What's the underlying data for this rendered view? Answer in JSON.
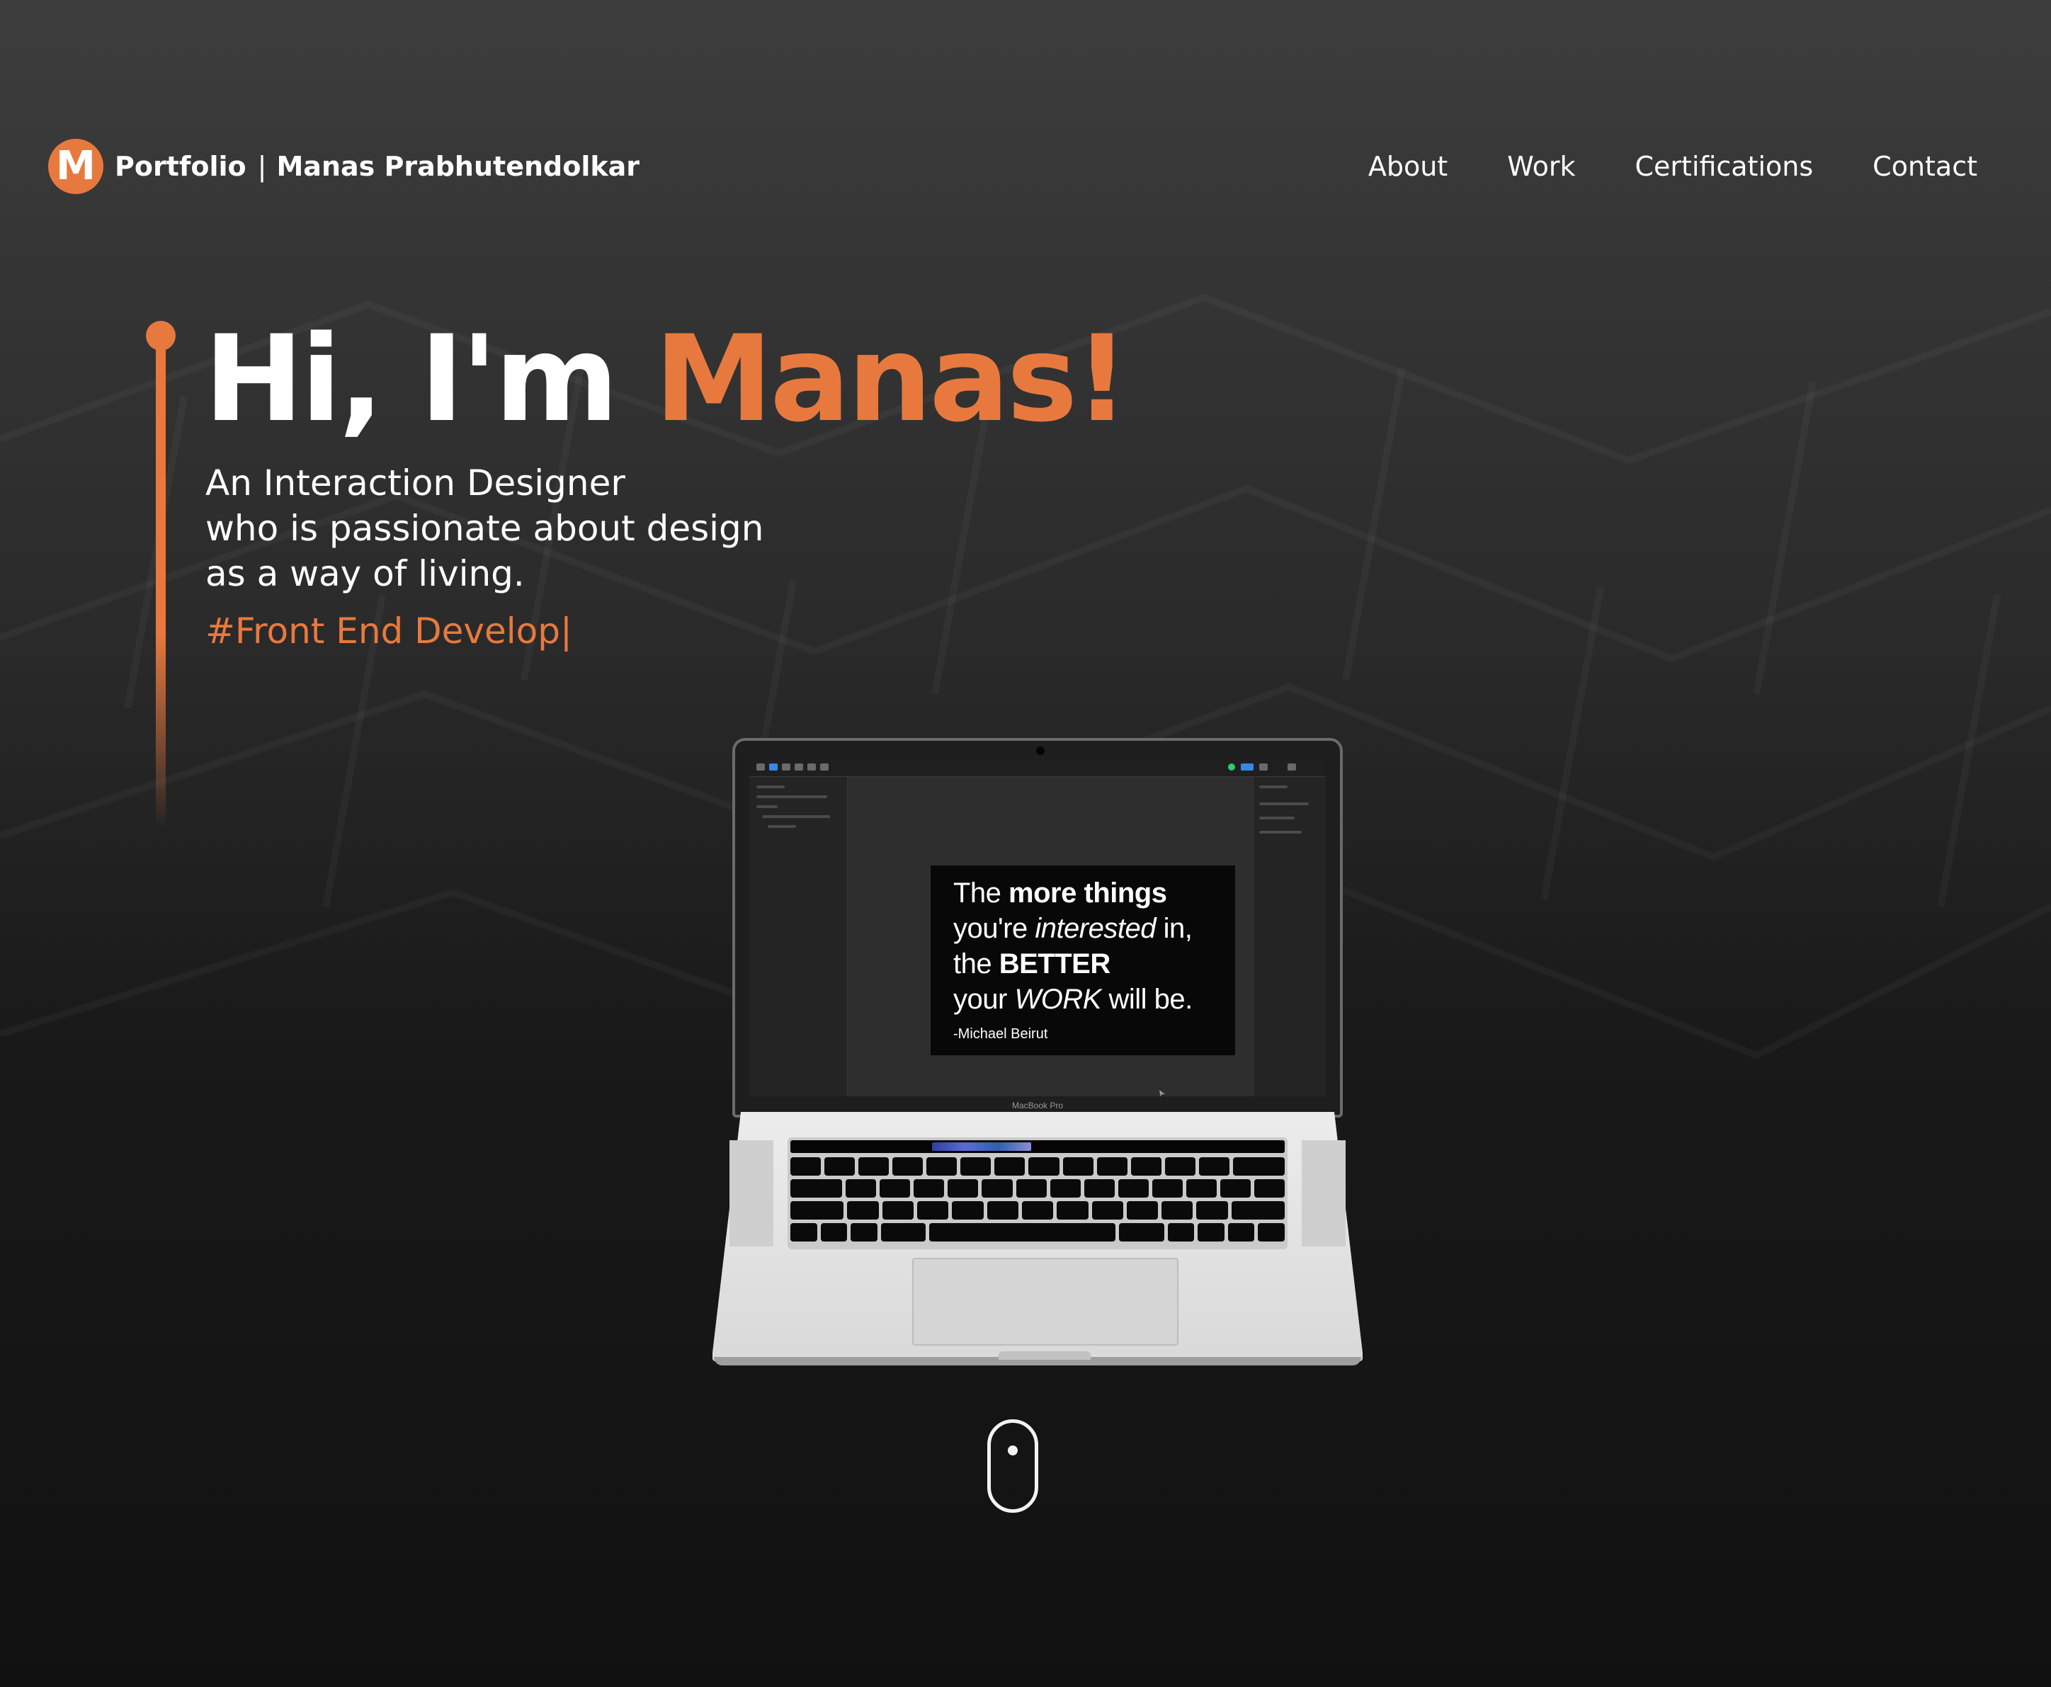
{
  "header": {
    "logo_letter": "M",
    "brand_primary": "Portfolio",
    "brand_separator": "|",
    "brand_secondary": "Manas Prabhutendolkar",
    "nav": [
      {
        "label": "About"
      },
      {
        "label": "Work"
      },
      {
        "label": "Certifications"
      },
      {
        "label": "Contact"
      }
    ]
  },
  "hero": {
    "greeting": "Hi, I'm",
    "name": "Manas!",
    "tagline_lines": [
      "An Interaction Designer",
      "who is passionate about design",
      "as a way of living."
    ],
    "typing_text": "#Front End Develop",
    "typing_cursor": "|"
  },
  "laptop": {
    "quote": {
      "line1_a": "The ",
      "line1_b": "more things",
      "line2_a": "you're ",
      "line2_b": "interested",
      "line2_c": " in,",
      "line3_a": "the ",
      "line3_b": "BETTER",
      "line4_a": "your ",
      "line4_b": "WORK",
      "line4_c": " will be.",
      "author": "-Michael Beirut"
    },
    "model_label": "MacBook Pro"
  },
  "scroll_indicator": {
    "icon": "mouse-scroll-icon"
  },
  "colors": {
    "accent": "#e8793e",
    "background_top": "#3d3d3d",
    "background_bottom": "#111111",
    "text": "#ffffff"
  }
}
